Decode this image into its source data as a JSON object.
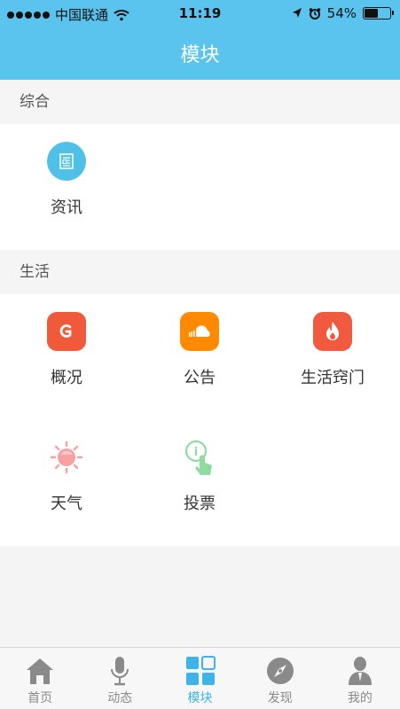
{
  "status_bar": {
    "carrier": "中国联通",
    "time": "11:19",
    "battery_percent": "54%",
    "battery_level": 0.54
  },
  "header": {
    "title": "模块"
  },
  "sections": [
    {
      "title": "综合",
      "items": [
        {
          "label": "资讯",
          "icon": "newspaper-icon",
          "color": "#4fc1e9"
        }
      ]
    },
    {
      "title": "生活",
      "items": [
        {
          "label": "概况",
          "icon": "g-logo-icon",
          "color": "#f05a3b"
        },
        {
          "label": "公告",
          "icon": "soundcloud-icon",
          "color": "#ff8a00"
        },
        {
          "label": "生活窍门",
          "icon": "flame-icon",
          "color": "#f15a3f"
        },
        {
          "label": "天气",
          "icon": "sun-icon",
          "color": "#f7a1a0"
        },
        {
          "label": "投票",
          "icon": "tap-info-icon",
          "color": "#8fdba0"
        }
      ]
    }
  ],
  "tab_bar": {
    "items": [
      {
        "label": "首页",
        "icon": "home-icon"
      },
      {
        "label": "动态",
        "icon": "microphone-icon"
      },
      {
        "label": "模块",
        "icon": "grid-icon"
      },
      {
        "label": "发现",
        "icon": "compass-icon"
      },
      {
        "label": "我的",
        "icon": "person-icon"
      }
    ],
    "active": "模块",
    "active_color": "#3db3e8",
    "inactive_color": "#8a8a8a"
  }
}
